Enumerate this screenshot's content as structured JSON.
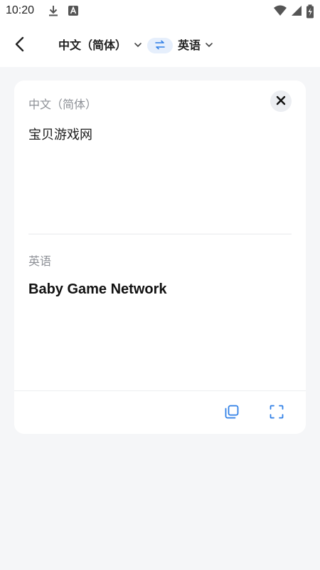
{
  "status_bar": {
    "time": "10:20",
    "icons": [
      "download-icon",
      "notification-a-icon",
      "wifi-icon",
      "signal-icon",
      "battery-charging-icon"
    ]
  },
  "header": {
    "source_language": "中文（简体）",
    "target_language": "英语",
    "icons": {
      "back": "chevron-left-icon",
      "dropdown": "chevron-down-icon",
      "swap": "swap-arrows-icon"
    }
  },
  "card": {
    "source_language_label": "中文（简体）",
    "source_text": "宝贝游戏网",
    "target_language_label": "英语",
    "translated_text": "Baby Game Network",
    "icons": {
      "clear": "close-icon",
      "copy": "copy-icon",
      "fullscreen": "fullscreen-icon"
    }
  },
  "colors": {
    "accent": "#2f7fe6",
    "swap_bg": "#e6effc",
    "page_bg": "#f5f6f8",
    "muted_text": "#8d9096"
  }
}
